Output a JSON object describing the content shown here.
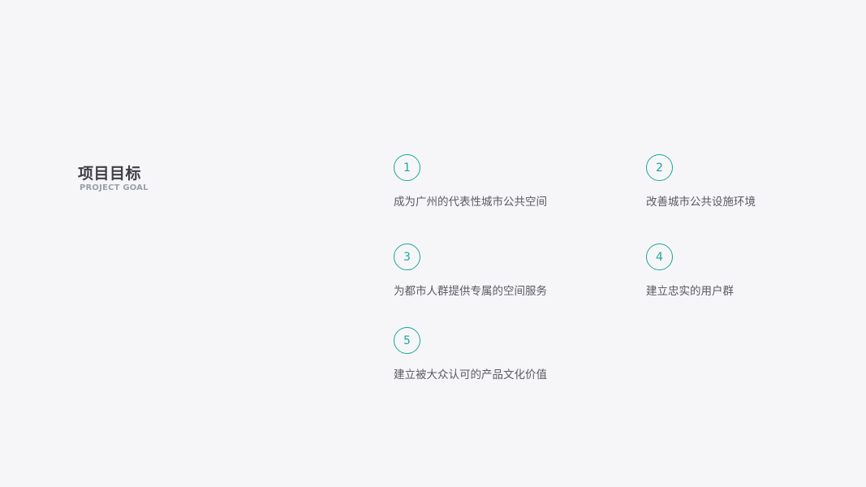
{
  "header": {
    "title": "项目目标",
    "subtitle": "PROJECT GOAL"
  },
  "colors": {
    "background": "#f6f6f8",
    "accent": "#1aa89a",
    "title": "#3f3f46",
    "subtitle": "#9aa0aa",
    "text": "#5a5a62"
  },
  "goals": [
    {
      "number": "1",
      "text": "成为广州的代表性城市公共空间"
    },
    {
      "number": "2",
      "text": "改善城市公共设施环境"
    },
    {
      "number": "3",
      "text": "为都市人群提供专属的空间服务"
    },
    {
      "number": "4",
      "text": "建立忠实的用户群"
    },
    {
      "number": "5",
      "text": "建立被大众认可的产品文化价值"
    }
  ]
}
